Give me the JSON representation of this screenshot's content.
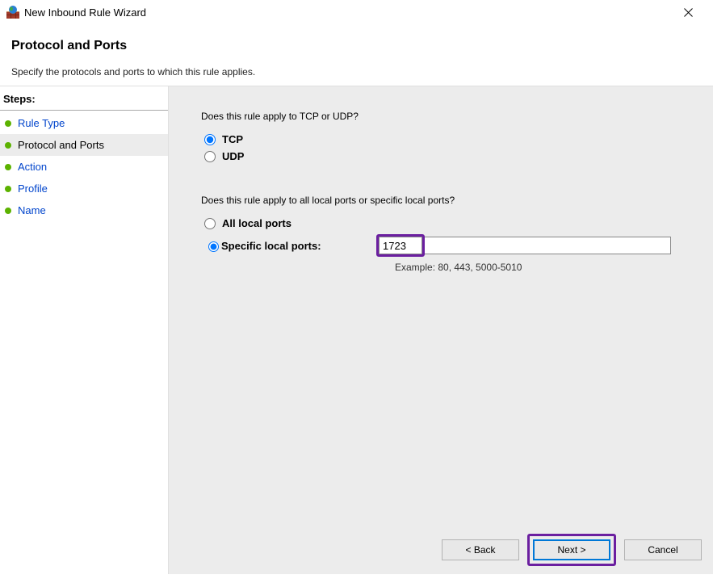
{
  "titlebar": {
    "title": "New Inbound Rule Wizard"
  },
  "header": {
    "title": "Protocol and Ports",
    "subtitle": "Specify the protocols and ports to which this rule applies."
  },
  "steps": {
    "header": "Steps:",
    "items": [
      {
        "label": "Rule Type",
        "current": false
      },
      {
        "label": "Protocol and Ports",
        "current": true
      },
      {
        "label": "Action",
        "current": false
      },
      {
        "label": "Profile",
        "current": false
      },
      {
        "label": "Name",
        "current": false
      }
    ]
  },
  "content": {
    "q1": "Does this rule apply to TCP or UDP?",
    "tcp_label": "TCP",
    "udp_label": "UDP",
    "protocol_selected": "tcp",
    "q2": "Does this rule apply to all local ports or specific local ports?",
    "all_ports_label": "All local ports",
    "specific_ports_label": "Specific local ports:",
    "ports_selected": "specific",
    "ports_value": "1723",
    "example": "Example: 80, 443, 5000-5010"
  },
  "buttons": {
    "back": "< Back",
    "next": "Next >",
    "cancel": "Cancel"
  }
}
